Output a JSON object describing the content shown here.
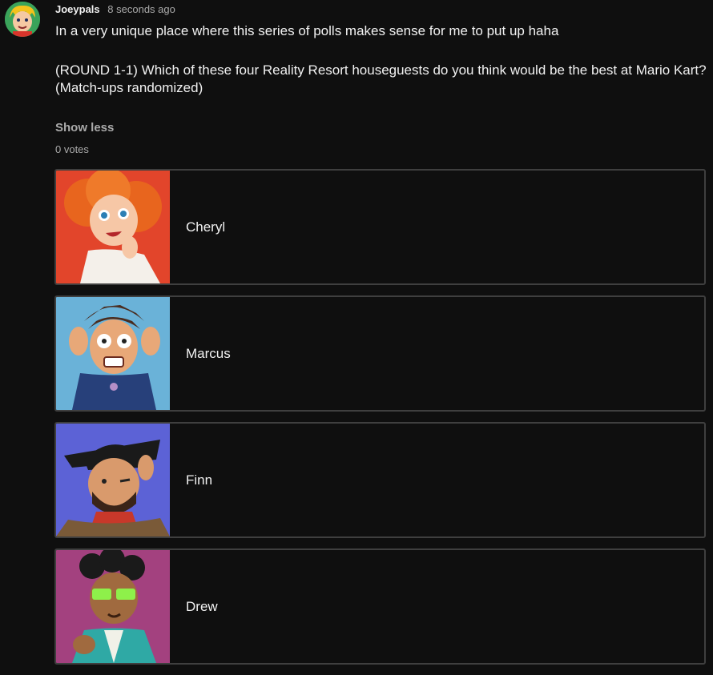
{
  "comment": {
    "author": "Joeypals",
    "timestamp": "8 seconds ago",
    "text_lines": [
      "In a very unique place where this series of polls makes sense for me to put up haha",
      "(ROUND 1-1) Which of these four Reality Resort houseguests do you think would be the best at Mario Kart?",
      "(Match-ups randomized)"
    ],
    "show_less_label": "Show less",
    "votes_label": "0 votes"
  },
  "poll": {
    "options": [
      {
        "label": "Cheryl",
        "thumb_bg": "#e2452b"
      },
      {
        "label": "Marcus",
        "thumb_bg": "#6ab2d8"
      },
      {
        "label": "Finn",
        "thumb_bg": "#5c62d6"
      },
      {
        "label": "Drew",
        "thumb_bg": "#a3417f"
      }
    ]
  },
  "colors": {
    "background": "#0f0f0f",
    "text_primary": "#f1f1f1",
    "text_secondary": "#aaaaaa",
    "option_border": "#3f3f3f"
  }
}
